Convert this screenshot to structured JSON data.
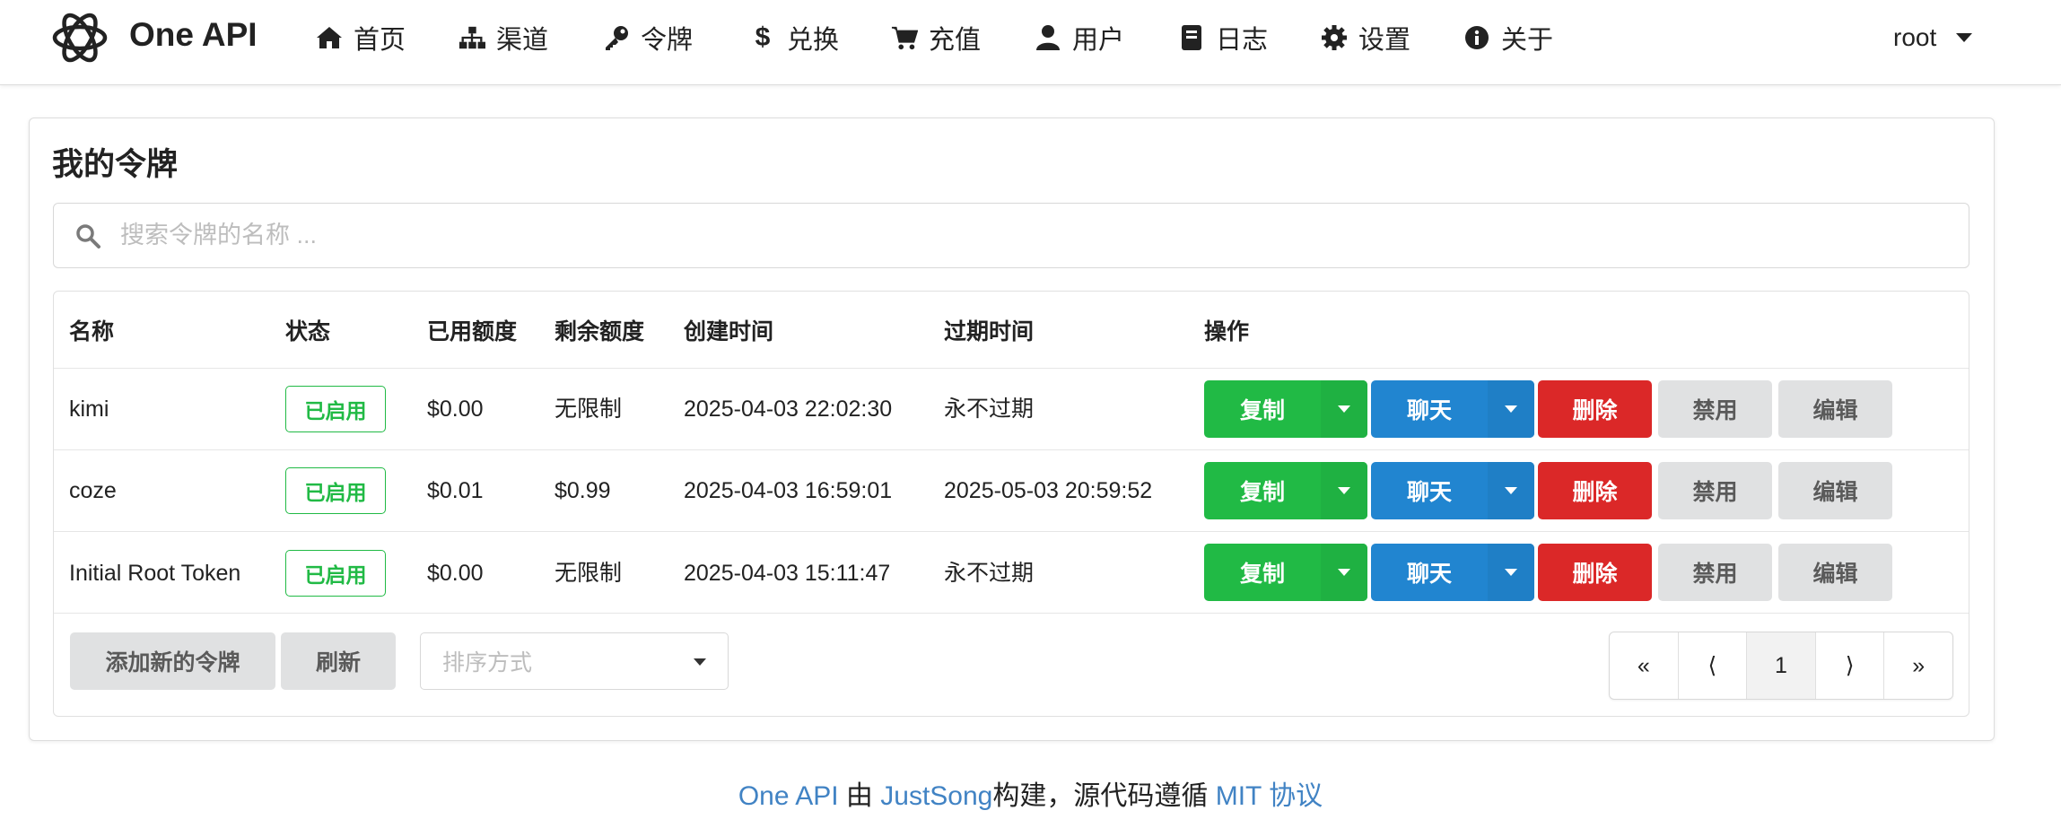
{
  "app": {
    "brand": "One API"
  },
  "nav": {
    "items": [
      {
        "label": "首页",
        "icon": "home-icon"
      },
      {
        "label": "渠道",
        "icon": "sitemap-icon"
      },
      {
        "label": "令牌",
        "icon": "key-icon"
      },
      {
        "label": "兑换",
        "icon": "dollar-icon"
      },
      {
        "label": "充值",
        "icon": "cart-icon"
      },
      {
        "label": "用户",
        "icon": "user-icon"
      },
      {
        "label": "日志",
        "icon": "book-icon"
      },
      {
        "label": "设置",
        "icon": "gear-icon"
      },
      {
        "label": "关于",
        "icon": "info-icon"
      }
    ],
    "user": "root"
  },
  "page": {
    "title": "我的令牌",
    "search_placeholder": "搜索令牌的名称 ..."
  },
  "table": {
    "headers": [
      "名称",
      "状态",
      "已用额度",
      "剩余额度",
      "创建时间",
      "过期时间",
      "操作"
    ],
    "rows": [
      {
        "name": "kimi",
        "status": "已启用",
        "used": "$0.00",
        "remaining": "无限制",
        "created": "2025-04-03 22:02:30",
        "expires": "永不过期"
      },
      {
        "name": "coze",
        "status": "已启用",
        "used": "$0.01",
        "remaining": "$0.99",
        "created": "2025-04-03 16:59:01",
        "expires": "2025-05-03 20:59:52"
      },
      {
        "name": "Initial Root Token",
        "status": "已启用",
        "used": "$0.00",
        "remaining": "无限制",
        "created": "2025-04-03 15:11:47",
        "expires": "永不过期"
      }
    ],
    "actions": {
      "copy": "复制",
      "chat": "聊天",
      "delete": "删除",
      "disable": "禁用",
      "edit": "编辑"
    }
  },
  "controls": {
    "add_label": "添加新的令牌",
    "refresh_label": "刷新",
    "sort_placeholder": "排序方式",
    "pagination": [
      "«",
      "⟨",
      "1",
      "⟩",
      "»"
    ],
    "current_page": "1"
  },
  "footer": {
    "brand_link": "One API",
    "by": "由",
    "author_link": "JustSong",
    "middle": "构建，源代码遵循",
    "license_link": "MIT 协议"
  },
  "colors": {
    "green": "#21ba45",
    "blue": "#2185d0",
    "red": "#db2828",
    "grey": "#e0e1e2",
    "link": "#4183c4"
  }
}
